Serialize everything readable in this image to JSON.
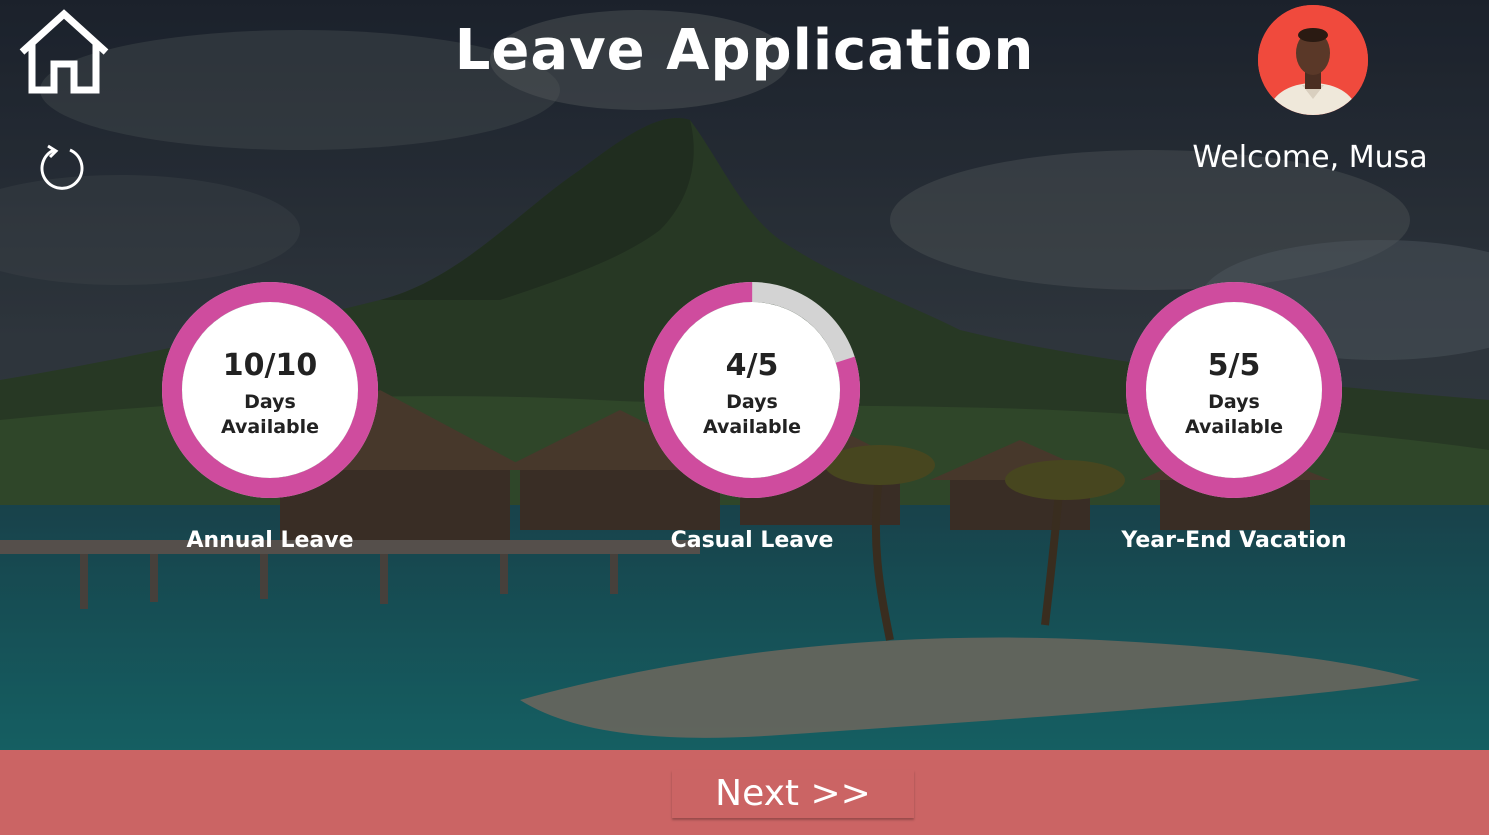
{
  "header": {
    "title": "Leave Application",
    "welcome": "Welcome, Musa"
  },
  "icons": {
    "home": "home-icon",
    "refresh": "refresh-icon",
    "avatar": "user-avatar"
  },
  "leave_balances": [
    {
      "available": 10,
      "total": 10,
      "value_text": "10/10",
      "unit_text": "Days\nAvailable",
      "label": "Annual Leave"
    },
    {
      "available": 4,
      "total": 5,
      "value_text": "4/5",
      "unit_text": "Days\nAvailable",
      "label": "Casual Leave"
    },
    {
      "available": 5,
      "total": 5,
      "value_text": "5/5",
      "unit_text": "Days\nAvailable",
      "label": "Year-End Vacation"
    }
  ],
  "footer": {
    "next_label": "Next >>"
  },
  "colors": {
    "ring_fill": "#cf4c9e",
    "ring_track": "#d3d3d3",
    "footer": "#cb6464",
    "avatar_bg": "#f04a3d"
  }
}
